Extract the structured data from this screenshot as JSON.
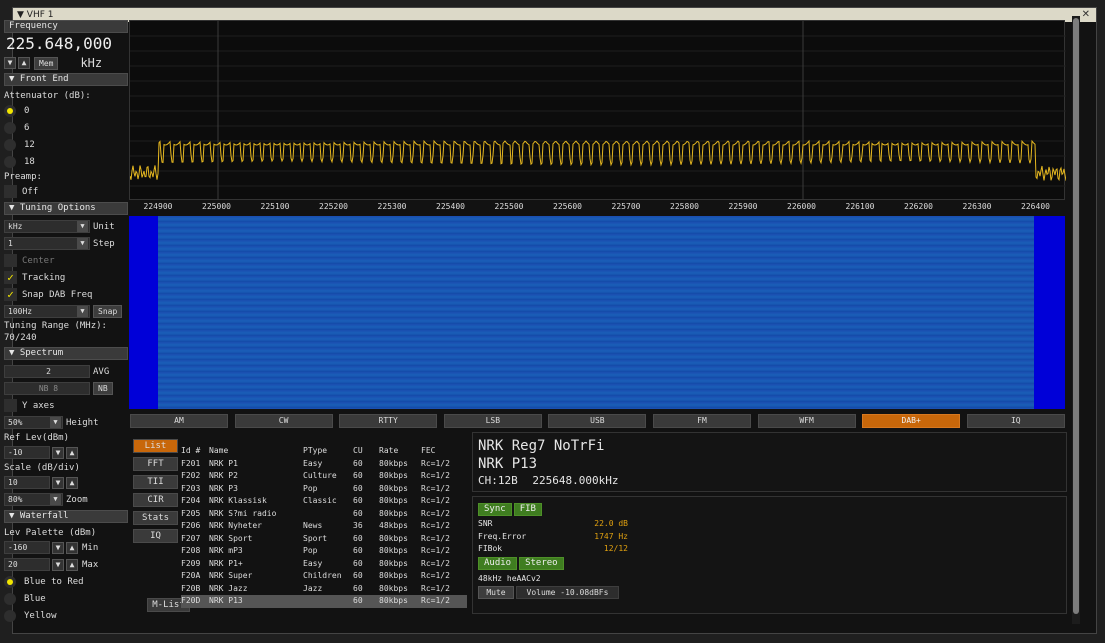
{
  "window": {
    "title": "▼ VHF 1",
    "close": "✕"
  },
  "left": {
    "frequency_label": "Frequency",
    "frequency_value": "225.648,000",
    "unit": "kHz",
    "mem_button": "Mem",
    "front_end": {
      "header": "▼  Front End",
      "attenuator_label": "Attenuator (dB):",
      "options": [
        "0",
        "6",
        "12",
        "18"
      ],
      "selected": "0",
      "preamp_label": "Preamp:",
      "preamp_value": "Off"
    },
    "tuning": {
      "header": "▼  Tuning Options",
      "unit_value": "kHz",
      "unit_label": "Unit",
      "step_value": "1",
      "step_label": "Step",
      "center_label": "Center",
      "tracking_label": "Tracking",
      "snap_dab_label": "Snap DAB Freq",
      "snap_value": "100Hz",
      "snap_button": "Snap",
      "range_label": "Tuning Range (MHz):",
      "range_value": "70/240"
    },
    "spectrum": {
      "header": "▼  Spectrum",
      "avg_value": "2",
      "avg_label": "AVG",
      "nb_value": "NB 8",
      "nb_button": "NB",
      "yaxes_label": "Y axes",
      "height_value": "50%",
      "height_label": "Height",
      "ref_label": "Ref Lev(dBm)",
      "ref_value": "-10",
      "scale_label": "Scale (dB/div)",
      "scale_value": "10",
      "zoom_value": "80%",
      "zoom_label": "Zoom"
    },
    "waterfall": {
      "header": "▼  Waterfall",
      "palette_label": "Lev Palette (dBm)",
      "min_value": "-160",
      "min_label": "Min",
      "max_value": "20",
      "max_label": "Max",
      "palettes": [
        "Blue to Red",
        "Blue",
        "Yellow"
      ],
      "selected": "Blue to Red"
    }
  },
  "spectrum_axis": [
    "224900",
    "225000",
    "225100",
    "225200",
    "225300",
    "225400",
    "225500",
    "225600",
    "225700",
    "225800",
    "225900",
    "226000",
    "226100",
    "226200",
    "226300",
    "226400"
  ],
  "modes": [
    "AM",
    "CW",
    "RTTY",
    "LSB",
    "USB",
    "FM",
    "WFM",
    "DAB+",
    "IQ"
  ],
  "active_mode": "DAB+",
  "tabs": [
    "List",
    "FFT",
    "TII",
    "CIR",
    "Stats",
    "IQ"
  ],
  "active_tab": "List",
  "mlist_button": "M-List",
  "services": {
    "headers": [
      "Id #",
      "Name",
      "PType",
      "CU",
      "Rate",
      "FEC"
    ],
    "rows": [
      [
        "F201",
        "NRK P1",
        "Easy",
        "60",
        "80kbps",
        "Rc=1/2"
      ],
      [
        "F202",
        "NRK P2",
        "Culture",
        "60",
        "80kbps",
        "Rc=1/2"
      ],
      [
        "F203",
        "NRK P3",
        "Pop",
        "60",
        "80kbps",
        "Rc=1/2"
      ],
      [
        "F204",
        "NRK Klassisk",
        "Classic",
        "60",
        "80kbps",
        "Rc=1/2"
      ],
      [
        "F205",
        "NRK S?mi radio",
        "",
        "60",
        "80kbps",
        "Rc=1/2"
      ],
      [
        "F206",
        "NRK Nyheter",
        "News",
        "36",
        "48kbps",
        "Rc=1/2"
      ],
      [
        "F207",
        "NRK Sport",
        "Sport",
        "60",
        "80kbps",
        "Rc=1/2"
      ],
      [
        "F208",
        "NRK mP3",
        "Pop",
        "60",
        "80kbps",
        "Rc=1/2"
      ],
      [
        "F209",
        "NRK P1+",
        "Easy",
        "60",
        "80kbps",
        "Rc=1/2"
      ],
      [
        "F20A",
        "NRK Super",
        "Children",
        "60",
        "80kbps",
        "Rc=1/2"
      ],
      [
        "F20B",
        "NRK Jazz",
        "Jazz",
        "60",
        "80kbps",
        "Rc=1/2"
      ],
      [
        "F20D",
        "NRK P13",
        "",
        "60",
        "80kbps",
        "Rc=1/2"
      ]
    ],
    "selected_index": 11
  },
  "info": {
    "ensemble": "NRK Reg7 NoTrFi",
    "service": "NRK P13",
    "channel": "CH:12B",
    "freq": "225648.000kHz"
  },
  "status": {
    "sync": "Sync",
    "fib": "FIB",
    "snr_label": "SNR",
    "snr_value": "22.0 dB",
    "ferr_label": "Freq.Error",
    "ferr_value": "1747 Hz",
    "fibok_label": "FIBok",
    "fibok_value": "12/12",
    "audio": "Audio",
    "stereo": "Stereo",
    "codec": "48kHz heAACv2",
    "mute": "Mute",
    "volume": "Volume -10.08dBFs"
  },
  "colors": {
    "accent": "#c8670a",
    "trace": "#e6b820",
    "waterfall_bg": "#0000d8",
    "green": "#3f7d20"
  }
}
